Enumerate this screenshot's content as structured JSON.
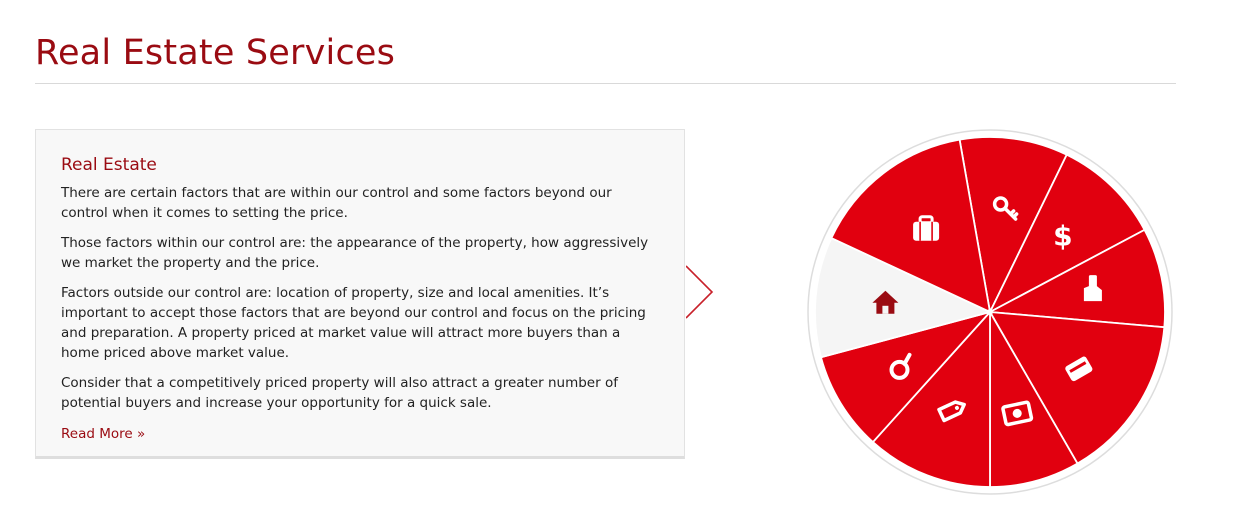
{
  "page": {
    "title": "Real Estate Services"
  },
  "panel": {
    "heading": "Real Estate",
    "paragraphs": [
      "There are certain factors that are within our control and some factors beyond our control when it comes to setting the price.",
      "Those factors within our control are: the appearance of the property, how aggressively we market the property and the price.",
      "Factors outside our control are: location of property, size and local amenities. It’s important to accept those factors that are beyond our control and focus on the pricing and preparation. A property priced at market value will attract more buyers than a home priced above market value.",
      "Consider that a competitively priced property will also attract a greater number of potential buyers and increase your opportunity for a quick sale."
    ],
    "read_more": "Read More »"
  },
  "wheel": {
    "active_color": "#f5f5f5",
    "segment_color": "#e1000f",
    "active_icon_color": "#9a0b12",
    "segments": [
      {
        "icon": "key-icon",
        "active": false
      },
      {
        "icon": "dollar-icon",
        "active": false
      },
      {
        "icon": "glove-icon",
        "active": false
      },
      {
        "icon": "card-icon",
        "active": false
      },
      {
        "icon": "money-icon",
        "active": false
      },
      {
        "icon": "price-tag-icon",
        "active": false
      },
      {
        "icon": "magnifier-icon",
        "active": false
      },
      {
        "icon": "house-icon",
        "active": true
      },
      {
        "icon": "briefcase-icon",
        "active": false
      }
    ]
  }
}
